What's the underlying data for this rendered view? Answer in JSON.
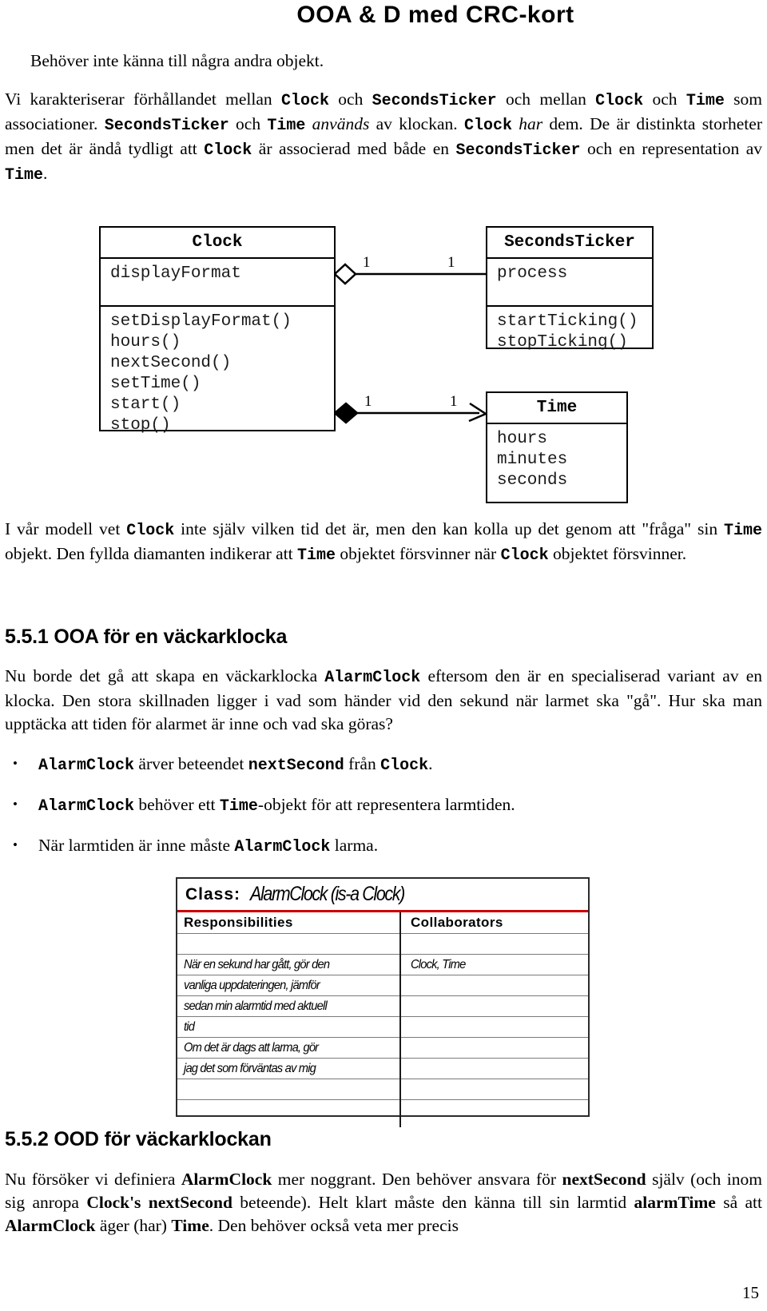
{
  "header": {
    "title": "OOA & D med CRC-kort"
  },
  "intro": {
    "line1": "Behöver inte känna till några andra objekt.",
    "para_parts": {
      "p1": "Vi karakteriserar förhållandet mellan ",
      "c1": "Clock",
      "p2": " och ",
      "c2": "SecondsTicker",
      "p3": " och mellan ",
      "c3": "Clock",
      "p4": " och ",
      "c4": "Time",
      "p5": " som associationer. ",
      "c5": "SecondsTicker",
      "p6": " och ",
      "c6": "Time",
      "i1": " används",
      "p7": " av klockan. ",
      "c7": "Clock",
      "i2": " har",
      "p8": " dem. De är distinkta storheter men det är ändå tydligt att ",
      "c8": "Clock",
      "p9": " är associerad med både en ",
      "c9": "SecondsTicker",
      "p10": " och en representation av ",
      "c10": "Time",
      "p11": "."
    }
  },
  "diagram": {
    "classes": [
      {
        "name": "Clock",
        "attributes": [
          "displayFormat"
        ],
        "operations": [
          "setDisplayFormat()",
          "hours()",
          "nextSecond()",
          "setTime()",
          "start()",
          "stop()"
        ]
      },
      {
        "name": "SecondsTicker",
        "attributes": [
          "process"
        ],
        "operations": [
          "startTicking()",
          "stopTicking()"
        ]
      },
      {
        "name": "Time",
        "attributes": [
          "hours",
          "minutes",
          "seconds"
        ],
        "operations": []
      }
    ],
    "associations": [
      {
        "from": "Clock",
        "to": "SecondsTicker",
        "kind": "aggregation-hollow-diamond",
        "source_multiplicity": "1",
        "target_multiplicity": "1"
      },
      {
        "from": "Clock",
        "to": "Time",
        "kind": "composition-filled-diamond-arrow",
        "source_multiplicity": "1",
        "target_multiplicity": "1"
      }
    ]
  },
  "after_diagram": {
    "parts": {
      "p1": "I vår modell vet ",
      "c1": "Clock",
      "p2": " inte själv vilken tid det är, men den kan kolla up det genom att \"fråga\" sin ",
      "c2": "Time",
      "p3": " objekt. Den fyllda diamanten indikerar att ",
      "c3": "Time",
      "p4": " objektet försvinner när ",
      "c4": "Clock",
      "p5": " objektet försvinner."
    }
  },
  "section_551": {
    "heading": "5.5.1 OOA för en väckarklocka",
    "paragraph": {
      "p1": "Nu borde det gå att skapa en väckarklocka ",
      "c1": "AlarmClock",
      "p2": " eftersom den är en specialiserad variant av en klocka. Den stora skillnaden ligger i vad som händer vid den sekund när larmet ska \"gå\". Hur ska man upptäcka att tiden för alarmet är inne och vad ska göras?"
    },
    "bullets": [
      {
        "dot": "•",
        "c1": "AlarmClock",
        "p1": " ärver beteendet ",
        "c2": "nextSecond",
        "p2": " från ",
        "c3": "Clock",
        "p3": "."
      },
      {
        "dot": "•",
        "c1": "AlarmClock",
        "p1": " behöver ett ",
        "c2": "Time",
        "p2": "-objekt för att representera larmtiden.",
        "c3": "",
        "p3": ""
      },
      {
        "dot": "•",
        "c1": "",
        "p1": "När larmtiden är inne måste ",
        "c2": "AlarmClock",
        "p2": " larma.",
        "c3": "",
        "p3": ""
      }
    ]
  },
  "crc_card": {
    "class_label": "Class:",
    "class_value": "AlarmClock (is-a Clock)",
    "col_headers": [
      "Responsibilities",
      "Collaborators"
    ],
    "rows": [
      {
        "responsibility": "",
        "collaborator": ""
      },
      {
        "responsibility": "När en sekund har gått, gör den",
        "collaborator": "Clock, Time"
      },
      {
        "responsibility": "vanliga uppdateringen, jämför",
        "collaborator": ""
      },
      {
        "responsibility": "sedan min alarmtid med aktuell",
        "collaborator": ""
      },
      {
        "responsibility": "tid",
        "collaborator": ""
      },
      {
        "responsibility": "Om det är dags att larma, gör",
        "collaborator": ""
      },
      {
        "responsibility": "jag det som förväntas av mig",
        "collaborator": ""
      },
      {
        "responsibility": "",
        "collaborator": ""
      },
      {
        "responsibility": "",
        "collaborator": ""
      }
    ],
    "accent_color": "#cc0000"
  },
  "section_552": {
    "heading": "5.5.2 OOD för väckarklockan",
    "paragraph": {
      "p1": "Nu försöker vi definiera ",
      "b1": "AlarmClock",
      "p2": " mer noggrant. Den behöver ansvara för ",
      "b2": "nextSecond",
      "p3": " själv (och inom sig anropa ",
      "b3": "Clock's nextSecond",
      "p4": " beteende). Helt klart måste den känna till sin larmtid ",
      "b4": "alarmTime",
      "p5": " så att ",
      "b5": "AlarmClock",
      "p6": " äger (har) ",
      "b6": "Time",
      "p7": ". Den behöver också veta mer precis"
    }
  },
  "footer": {
    "page_number": "15"
  }
}
